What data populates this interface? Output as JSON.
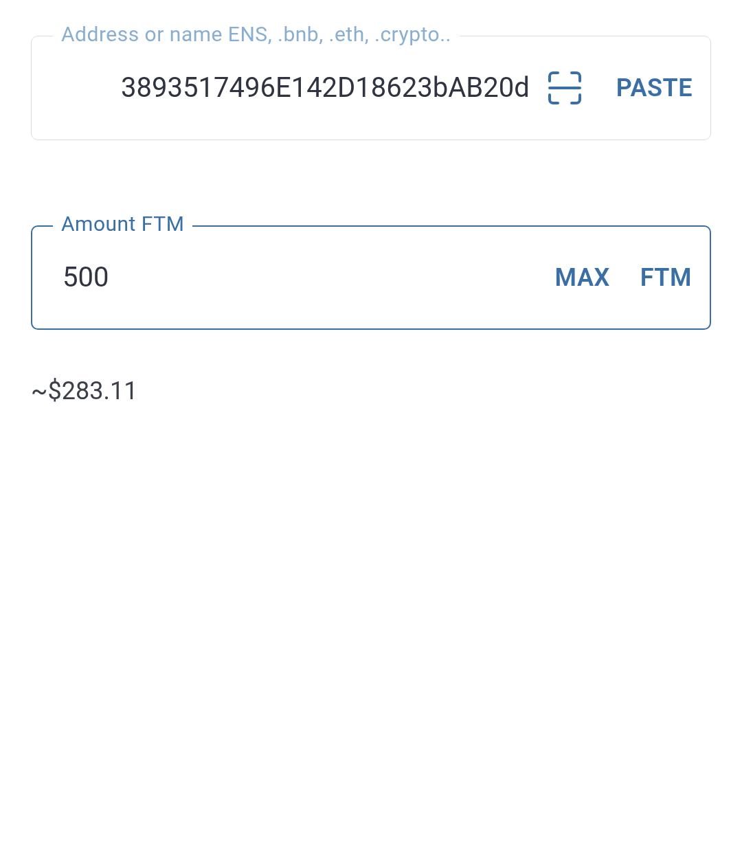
{
  "fields": [
    {
      "kind": "address",
      "label": "Address or name ENS, .bnb, .eth, .crypto..",
      "value": "3893517496E142D18623bAB20d",
      "focused": false,
      "actions": [
        "PASTE"
      ]
    },
    {
      "kind": "amount",
      "label": "Amount FTM",
      "value": "500",
      "focused": true,
      "actions": [
        "MAX",
        "FTM"
      ]
    }
  ],
  "fiat_value": "~$283.11"
}
